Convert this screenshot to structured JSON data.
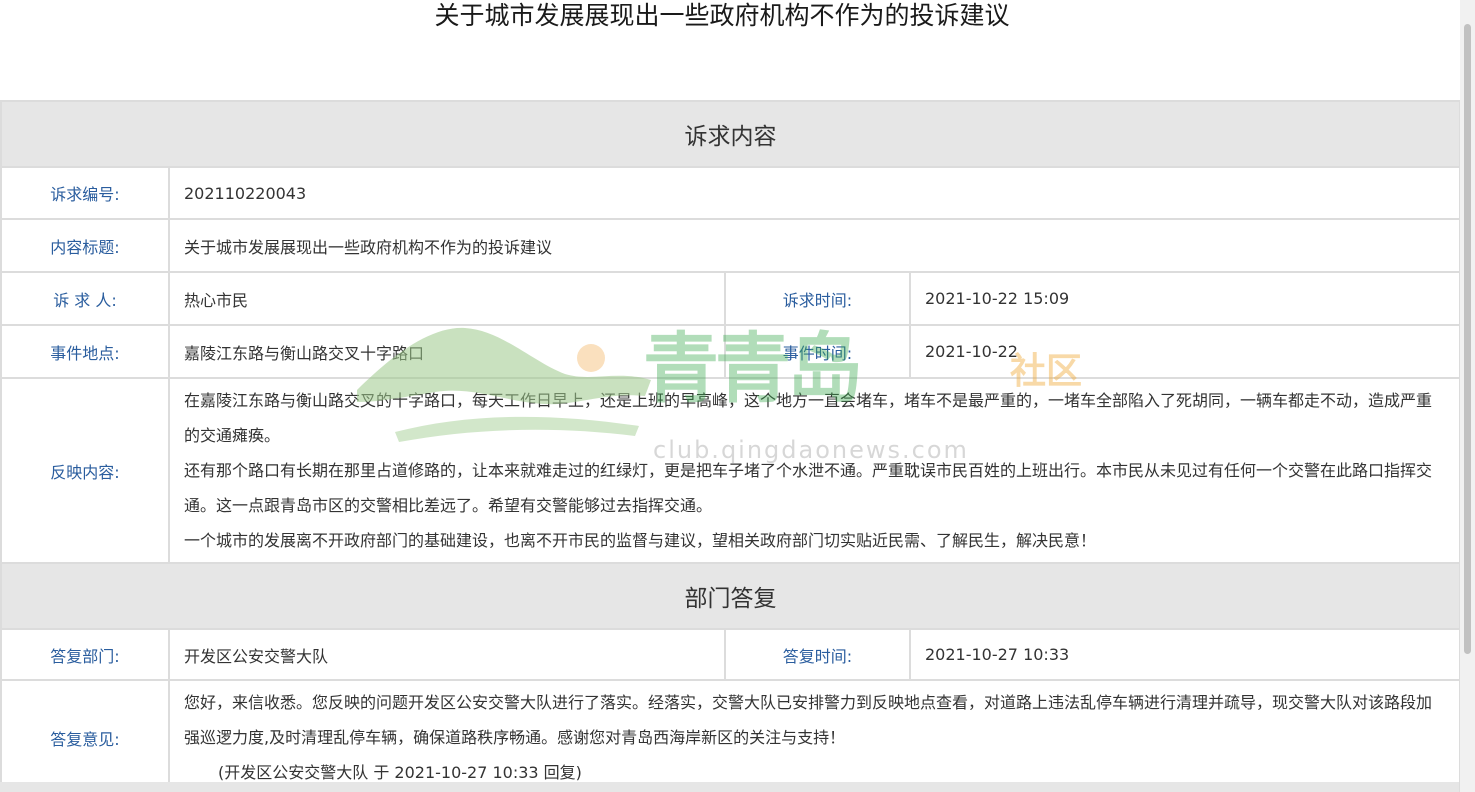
{
  "page": {
    "title": "关于城市发展展现出一些政府机构不作为的投诉建议"
  },
  "appeal": {
    "section_title": "诉求内容",
    "fields": {
      "number_label": "诉求编号:",
      "number_value": "202110220043",
      "subject_label": "内容标题:",
      "subject_value": "关于城市发展展现出一些政府机构不作为的投诉建议",
      "petitioner_label": "诉 求 人:",
      "petitioner_value": "热心市民",
      "time_label": "诉求时间:",
      "time_value": "2021-10-22 15:09",
      "location_label": "事件地点:",
      "location_value": "嘉陵江东路与衡山路交叉十字路口",
      "event_time_label": "事件时间:",
      "event_time_value": "2021-10-22",
      "content_label": "反映内容:"
    },
    "content_paragraphs": [
      "在嘉陵江东路与衡山路交叉的十字路口，每天工作日早上，还是上班的早高峰，这个地方一直会堵车，堵车不是最严重的，一堵车全部陷入了死胡同，一辆车都走不动，造成严重的交通瘫痪。",
      "还有那个路口有长期在那里占道修路的，让本来就难走过的红绿灯，更是把车子堵了个水泄不通。严重耽误市民百姓的上班出行。本市民从未见过有任何一个交警在此路口指挥交通。这一点跟青岛市区的交警相比差远了。希望有交警能够过去指挥交通。",
      "一个城市的发展离不开政府部门的基础建设，也离不开市民的监督与建议，望相关政府部门切实贴近民需、了解民生，解决民意！"
    ]
  },
  "reply": {
    "section_title": "部门答复",
    "fields": {
      "dept_label": "答复部门:",
      "dept_value": "开发区公安交警大队",
      "time_label": "答复时间:",
      "time_value": "2021-10-27 10:33",
      "opinion_label": "答复意见:"
    },
    "opinion_text": "您好，来信收悉。您反映的问题开发区公安交警大队进行了落实。经落实，交警大队已安排警力到反映地点查看，对道路上违法乱停车辆进行清理并疏导，现交警大队对该路段加强巡逻力度,及时清理乱停车辆，确保道路秩序畅通。感谢您对青岛西海岸新区的关注与支持！",
    "signoff": "(开发区公安交警大队 于 2021-10-27 10:33 回复)"
  },
  "watermark": {
    "name": "青青岛",
    "community": "社区",
    "url": "club.qingdaonews.com",
    "colors": {
      "mountain": "#9cc98a",
      "sun": "#f3b15c",
      "text": "#3caa50"
    }
  }
}
